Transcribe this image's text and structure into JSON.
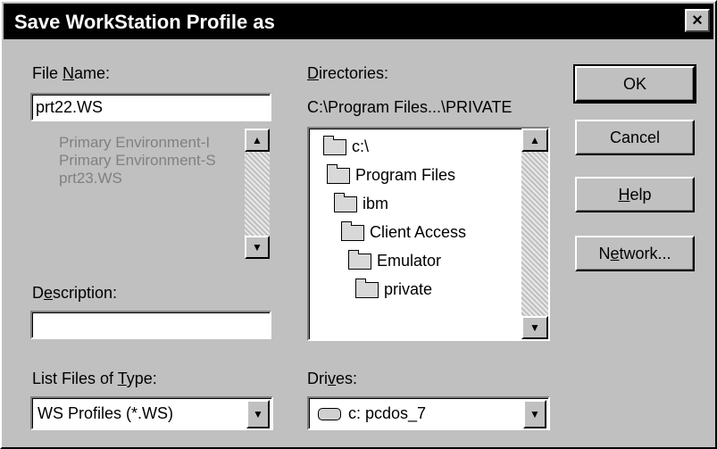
{
  "window": {
    "title": "Save WorkStation Profile as",
    "close_glyph": "×"
  },
  "file_name": {
    "label_pre": "File ",
    "label_u": "N",
    "label_post": "ame:",
    "value": "prt22.WS",
    "items": [
      "Primary Environment-I",
      "Primary Environment-S",
      "prt23.WS"
    ]
  },
  "directories": {
    "label_u": "D",
    "label_post": "irectories:",
    "path": "C:\\Program Files...\\PRIVATE",
    "items": [
      "c:\\",
      "Program Files",
      "ibm",
      "Client Access",
      "Emulator",
      "private"
    ]
  },
  "description": {
    "label_pre": "D",
    "label_u": "e",
    "label_post": "scription:",
    "value": ""
  },
  "file_type": {
    "label_pre": "List Files of ",
    "label_u": "T",
    "label_post": "ype:",
    "value": "WS Profiles (*.WS)"
  },
  "drives": {
    "label_pre": "Dri",
    "label_u": "v",
    "label_post": "es:",
    "value": "c: pcdos_7"
  },
  "buttons": {
    "ok": "OK",
    "cancel": "Cancel",
    "help_u": "H",
    "help_post": "elp",
    "network_pre": "N",
    "network_u": "e",
    "network_post": "twork..."
  },
  "icons": {
    "folder": "folder-icon",
    "drive": "drive-icon",
    "up_arrow": "▲",
    "down_arrow": "▼"
  }
}
